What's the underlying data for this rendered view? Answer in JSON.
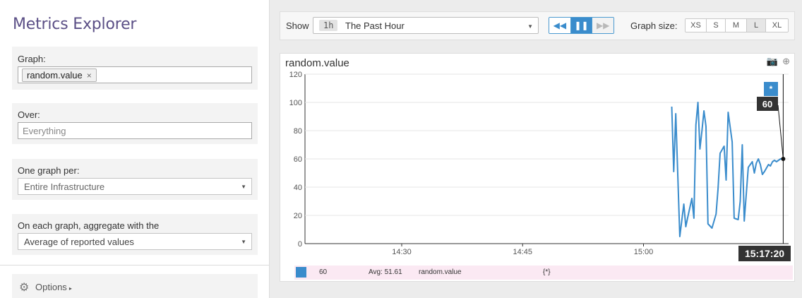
{
  "sidebar": {
    "title": "Metrics Explorer",
    "graph": {
      "label": "Graph:",
      "chip": "random.value",
      "chip_remove": "×"
    },
    "over": {
      "label": "Over:",
      "placeholder": "Everything"
    },
    "per": {
      "label": "One graph per:",
      "value": "Entire Infrastructure"
    },
    "aggregate": {
      "label": "On each graph, aggregate with the",
      "value": "Average of reported values"
    },
    "options": {
      "label": "Options",
      "arrow": "▸",
      "icon": "gear-icon"
    }
  },
  "toolbar": {
    "show_label": "Show",
    "duration": "1h",
    "time_value": "The Past Hour",
    "graph_size_label": "Graph size:",
    "sizes": [
      "XS",
      "S",
      "M",
      "L",
      "XL"
    ],
    "active_size": "L",
    "accent": "#3a8ccc"
  },
  "graph": {
    "title": "random.value",
    "marker_label": "*",
    "marker_value": "60",
    "time_label": "15:17:20",
    "legend": {
      "value": "60",
      "avg": "Avg: 51.61",
      "metric": "random.value",
      "scope": "{*}"
    }
  },
  "chart_data": {
    "type": "line",
    "title": "random.value",
    "xlabel": "",
    "ylabel": "",
    "ylim": [
      0,
      120
    ],
    "y_ticks": [
      0,
      20,
      40,
      60,
      80,
      100,
      120
    ],
    "x_ticks": [
      "14:30",
      "14:45",
      "15:00"
    ],
    "xlim": [
      "14:18",
      "15:18"
    ],
    "grid": true,
    "color": "#3a8ccc",
    "series": [
      {
        "x": [
          "15:03:30",
          "15:03:45",
          "15:04:00",
          "15:04:30",
          "15:05:00",
          "15:05:15",
          "15:05:30",
          "15:06:00",
          "15:06:15",
          "15:06:30",
          "15:06:45",
          "15:07:00",
          "15:07:15",
          "15:07:30",
          "15:07:45",
          "15:08:00",
          "15:08:30",
          "15:09:00",
          "15:09:15",
          "15:09:30",
          "15:10:00",
          "15:10:15",
          "15:10:30",
          "15:11:00",
          "15:11:15",
          "15:11:45",
          "15:12:00",
          "15:12:15",
          "15:12:30",
          "15:13:00",
          "15:13:30",
          "15:13:45",
          "15:14:00",
          "15:14:15",
          "15:14:30",
          "15:14:45",
          "15:15:00",
          "15:15:30",
          "15:15:45",
          "15:16:00",
          "15:16:15",
          "15:16:30",
          "15:17:00",
          "15:17:20"
        ],
        "y": [
          97,
          51,
          92,
          5,
          28,
          12,
          19,
          32,
          18,
          84,
          100,
          67,
          80,
          94,
          83,
          14,
          11,
          21,
          39,
          64,
          69,
          45,
          93,
          72,
          18,
          17,
          30,
          70,
          16,
          54,
          58,
          50,
          57,
          60,
          56,
          49,
          51,
          56,
          55,
          58,
          59,
          58,
          60,
          60
        ]
      }
    ]
  }
}
